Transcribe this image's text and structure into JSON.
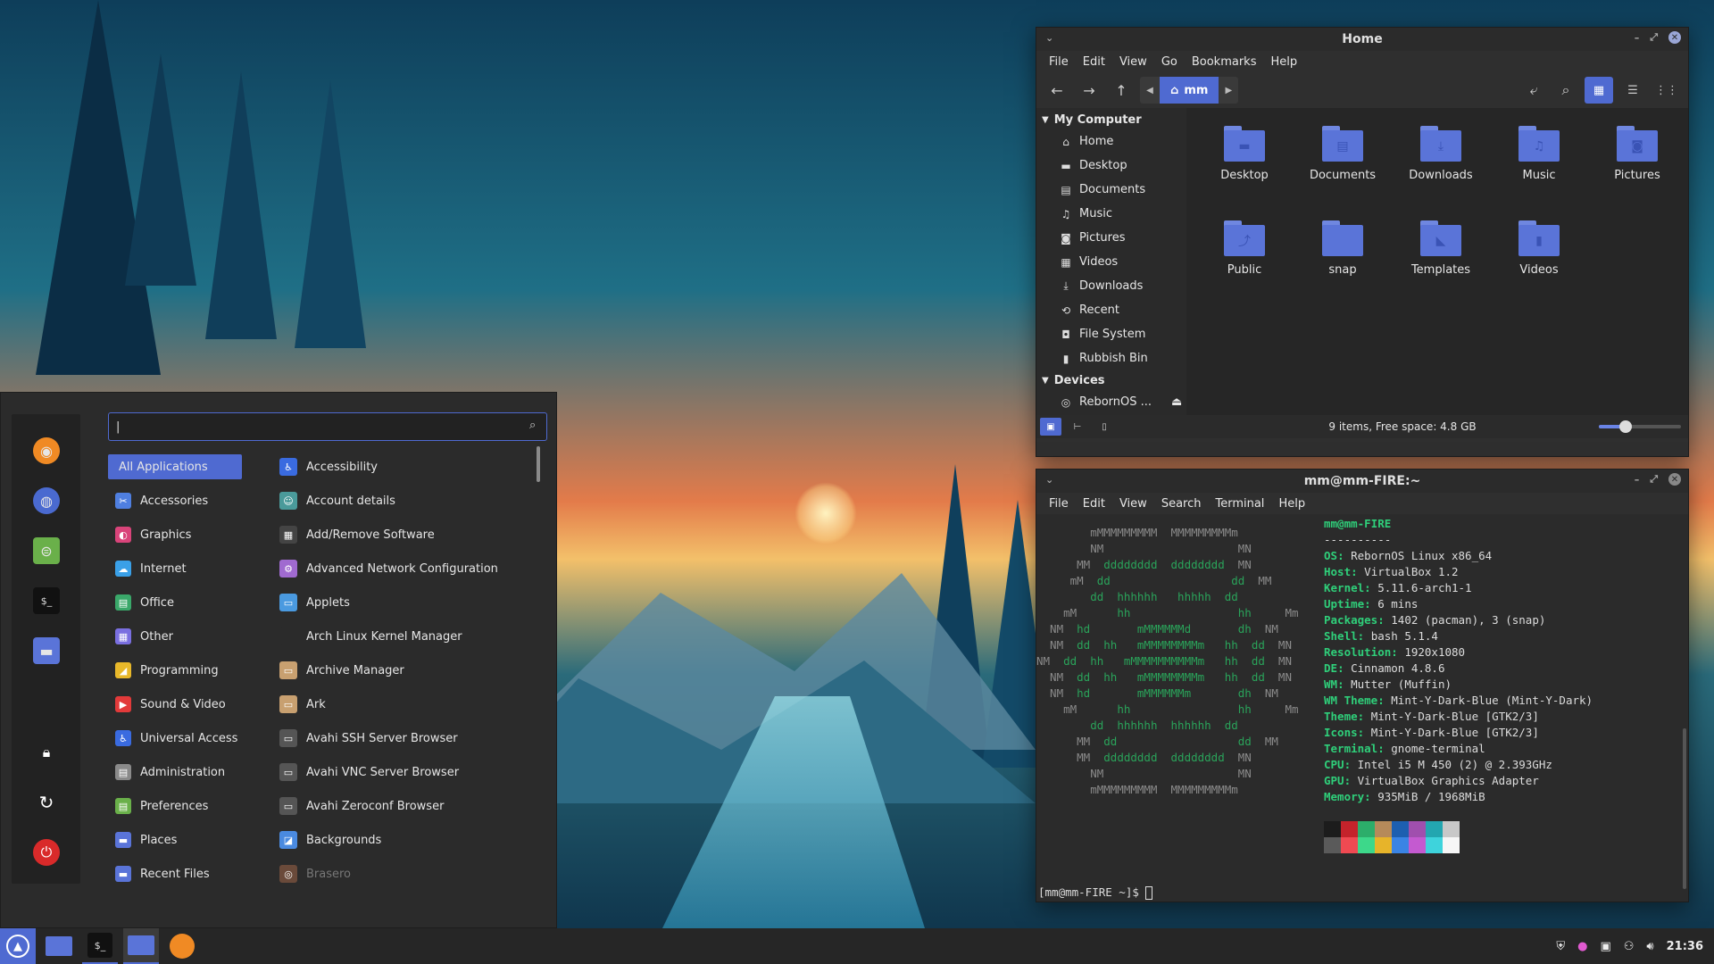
{
  "file_manager": {
    "title": "Home",
    "menu": [
      "File",
      "Edit",
      "View",
      "Go",
      "Bookmarks",
      "Help"
    ],
    "path_crumb": "mm",
    "sidebar": {
      "section_computer": "My Computer",
      "computer_items": [
        {
          "label": "Home",
          "icon": "home-icon"
        },
        {
          "label": "Desktop",
          "icon": "desktop-icon"
        },
        {
          "label": "Documents",
          "icon": "documents-icon"
        },
        {
          "label": "Music",
          "icon": "music-icon"
        },
        {
          "label": "Pictures",
          "icon": "pictures-icon"
        },
        {
          "label": "Videos",
          "icon": "videos-icon"
        },
        {
          "label": "Downloads",
          "icon": "downloads-icon"
        },
        {
          "label": "Recent",
          "icon": "recent-icon"
        },
        {
          "label": "File System",
          "icon": "filesystem-icon"
        },
        {
          "label": "Rubbish Bin",
          "icon": "trash-icon"
        }
      ],
      "section_devices": "Devices",
      "device_items": [
        {
          "label": "RebornOS ...",
          "icon": "disc-icon"
        }
      ]
    },
    "folders": [
      {
        "label": "Desktop",
        "icon": "folder-desktop-icon"
      },
      {
        "label": "Documents",
        "icon": "folder-documents-icon"
      },
      {
        "label": "Downloads",
        "icon": "folder-downloads-icon"
      },
      {
        "label": "Music",
        "icon": "folder-music-icon"
      },
      {
        "label": "Pictures",
        "icon": "folder-pictures-icon"
      },
      {
        "label": "Public",
        "icon": "folder-public-icon"
      },
      {
        "label": "snap",
        "icon": "folder-icon"
      },
      {
        "label": "Templates",
        "icon": "folder-templates-icon"
      },
      {
        "label": "Videos",
        "icon": "folder-videos-icon"
      }
    ],
    "status": "9 items, Free space: 4.8 GB",
    "zoom_level": 0.33
  },
  "terminal": {
    "title": "mm@mm-FIRE:~",
    "menu": [
      "File",
      "Edit",
      "View",
      "Search",
      "Terminal",
      "Help"
    ],
    "user_host": "mm@mm-FIRE",
    "separator": "----------",
    "info": [
      {
        "key": "OS",
        "value": "RebornOS Linux x86_64"
      },
      {
        "key": "Host",
        "value": "VirtualBox 1.2"
      },
      {
        "key": "Kernel",
        "value": "5.11.6-arch1-1"
      },
      {
        "key": "Uptime",
        "value": "6 mins"
      },
      {
        "key": "Packages",
        "value": "1402 (pacman), 3 (snap)"
      },
      {
        "key": "Shell",
        "value": "bash 5.1.4"
      },
      {
        "key": "Resolution",
        "value": "1920x1080"
      },
      {
        "key": "DE",
        "value": "Cinnamon 4.8.6"
      },
      {
        "key": "WM",
        "value": "Mutter (Muffin)"
      },
      {
        "key": "WM Theme",
        "value": "Mint-Y-Dark-Blue (Mint-Y-Dark)"
      },
      {
        "key": "Theme",
        "value": "Mint-Y-Dark-Blue [GTK2/3]"
      },
      {
        "key": "Icons",
        "value": "Mint-Y-Dark-Blue [GTK2/3]"
      },
      {
        "key": "Terminal",
        "value": "gnome-terminal"
      },
      {
        "key": "CPU",
        "value": "Intel i5 M 450 (2) @ 2.393GHz"
      },
      {
        "key": "GPU",
        "value": "VirtualBox Graphics Adapter"
      },
      {
        "key": "Memory",
        "value": "935MiB / 1968MiB"
      }
    ],
    "palette_top": [
      "#1c1c1c",
      "#c4232b",
      "#2cae6a",
      "#b68a5a",
      "#1d5fb0",
      "#a04fae",
      "#23a6b0",
      "#c8c8c8"
    ],
    "palette_bottom": [
      "#5a5a5a",
      "#ef4a52",
      "#3dd88a",
      "#e7b42a",
      "#3a84e4",
      "#c45ad0",
      "#3ed3dc",
      "#f6f6f6"
    ],
    "prompt": "[mm@mm-FIRE ~]$ "
  },
  "app_menu": {
    "search_value": "|",
    "categories": [
      {
        "label": "All Applications",
        "icon": "",
        "color": ""
      },
      {
        "label": "Accessories",
        "icon": "accessories-icon",
        "color": "#4f7fe0"
      },
      {
        "label": "Graphics",
        "icon": "graphics-icon",
        "color": "#d9447a"
      },
      {
        "label": "Internet",
        "icon": "internet-icon",
        "color": "#3aa0e8"
      },
      {
        "label": "Office",
        "icon": "office-icon",
        "color": "#3aa86a"
      },
      {
        "label": "Other",
        "icon": "other-icon",
        "color": "#7a6fe0"
      },
      {
        "label": "Programming",
        "icon": "programming-icon",
        "color": "#e8b82a"
      },
      {
        "label": "Sound & Video",
        "icon": "sound-video-icon",
        "color": "#e23a3a"
      },
      {
        "label": "Universal Access",
        "icon": "universal-access-icon",
        "color": "#3a6be0"
      },
      {
        "label": "Administration",
        "icon": "administration-icon",
        "color": "#8a8a8a"
      },
      {
        "label": "Preferences",
        "icon": "preferences-icon",
        "color": "#6ab04a"
      },
      {
        "label": "Places",
        "icon": "places-icon",
        "color": "#5a74d8"
      },
      {
        "label": "Recent Files",
        "icon": "recent-files-icon",
        "color": "#5a74d8"
      }
    ],
    "apps": [
      {
        "label": "Accessibility",
        "icon": "accessibility-icon",
        "color": "#3a6be0",
        "dim": false
      },
      {
        "label": "Account details",
        "icon": "account-icon",
        "color": "#4a9a9a",
        "dim": false
      },
      {
        "label": "Add/Remove Software",
        "icon": "software-icon",
        "color": "#444",
        "dim": false
      },
      {
        "label": "Advanced Network Configuration",
        "icon": "network-icon",
        "color": "#a06ad0",
        "dim": false
      },
      {
        "label": "Applets",
        "icon": "applets-icon",
        "color": "#4a9ae0",
        "dim": false
      },
      {
        "label": "Arch Linux Kernel Manager",
        "icon": "kernel-icon",
        "color": "#2b2b2b",
        "dim": false
      },
      {
        "label": "Archive Manager",
        "icon": "archive-icon",
        "color": "#c8a070",
        "dim": false
      },
      {
        "label": "Ark",
        "icon": "ark-icon",
        "color": "#c8a070",
        "dim": false
      },
      {
        "label": "Avahi SSH Server Browser",
        "icon": "monitor-icon",
        "color": "#555",
        "dim": false
      },
      {
        "label": "Avahi VNC Server Browser",
        "icon": "monitor-icon",
        "color": "#555",
        "dim": false
      },
      {
        "label": "Avahi Zeroconf Browser",
        "icon": "monitor-icon",
        "color": "#555",
        "dim": false
      },
      {
        "label": "Backgrounds",
        "icon": "backgrounds-icon",
        "color": "#4a8ae0",
        "dim": false
      },
      {
        "label": "Brasero",
        "icon": "brasero-icon",
        "color": "#6a4a3a",
        "dim": true
      }
    ],
    "favorites": [
      "firefox-icon",
      "settings-icon",
      "toggle-icon",
      "terminal-icon",
      "folder-icon",
      "lock-icon",
      "logout-icon",
      "power-icon"
    ]
  },
  "taskbar": {
    "clock": "21:36",
    "items": [
      "menu-icon",
      "files-icon",
      "terminal-icon",
      "files-icon",
      "firefox-icon"
    ],
    "tray": [
      "shield-icon",
      "firefox-tray-icon",
      "screen-icon",
      "network-icon",
      "volume-icon"
    ]
  }
}
